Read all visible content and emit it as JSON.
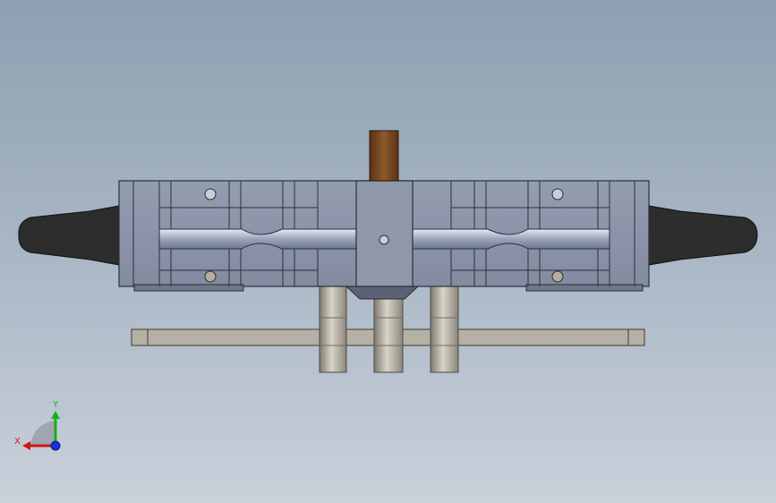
{
  "window": {
    "title": ""
  },
  "viewport": {
    "view_orientation": "front",
    "background_gradient": [
      "#8e9fb1",
      "#a6b4c3",
      "#c9d1da"
    ],
    "model": {
      "body_color": "#8c95a8",
      "body_dark": "#5d6577",
      "handle_color": "#2e2e2e",
      "post_color": "#a9a397",
      "pin_color": "#7a4a22",
      "plate_color": "#b7b2a6"
    }
  },
  "triad": {
    "x_label": "X",
    "y_label": "Y",
    "x_color": "#d01818",
    "y_color": "#18b018",
    "z_color": "#1a2fd0"
  }
}
